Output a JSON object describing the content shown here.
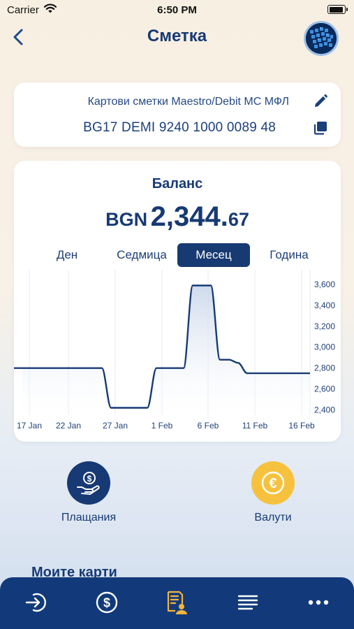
{
  "status_bar": {
    "carrier": "Carrier",
    "time": "6:50 PM"
  },
  "nav": {
    "title": "Сметка",
    "back_icon": "chevron-left-icon",
    "avatar": "profile-avatar"
  },
  "account": {
    "name": "Картови сметки Maestro/Debit MC МФЛ",
    "iban": "BG17 DEMI 9240 1000 0089 48",
    "edit_icon": "pencil-icon",
    "copy_icon": "copy-icon"
  },
  "balance": {
    "title": "Баланс",
    "currency": "BGN",
    "amount_integer": "2,344.",
    "amount_decimal": "67"
  },
  "periods": {
    "day": "Ден",
    "week": "Седмица",
    "month": "Месец",
    "year": "Година",
    "selected": "Месец"
  },
  "chart_data": {
    "type": "line",
    "x": [
      "12 Jan",
      "15 Jan",
      "16 Jan",
      "17 Jan",
      "22 Jan",
      "25 Jan",
      "26 Jan",
      "27 Jan",
      "30 Jan",
      "31 Jan",
      "1 Feb",
      "3 Feb",
      "4 Feb",
      "6 Feb",
      "7 Feb",
      "8 Feb",
      "9 Feb",
      "10 Feb",
      "16 Feb"
    ],
    "values": [
      2800,
      2800,
      2800,
      2800,
      2800,
      2800,
      2420,
      2420,
      2420,
      2800,
      2800,
      2800,
      3590,
      3590,
      2880,
      2880,
      2850,
      2750,
      2750
    ],
    "x_ticks": [
      "17 Jan",
      "22 Jan",
      "27 Jan",
      "1 Feb",
      "6 Feb",
      "11 Feb",
      "16 Feb"
    ],
    "y_ticks": [
      "2,400",
      "2,600",
      "2,800",
      "3,000",
      "3,200",
      "3,400",
      "3,600"
    ],
    "ylim": [
      2350,
      3700
    ],
    "grid": "vertical",
    "area_fill": true,
    "line_color": "#173a75"
  },
  "actions": {
    "payments": {
      "label": "Плащания",
      "icon": "hand-money-icon",
      "color": "#173a75"
    },
    "currencies": {
      "label": "Валути",
      "icon": "euro-icon",
      "color": "#f6c23e"
    }
  },
  "cards_heading": "Моите карти",
  "tabbar": {
    "items": [
      {
        "icon": "login-arrow-icon"
      },
      {
        "icon": "dollar-circle-icon"
      },
      {
        "icon": "document-user-icon",
        "active": true
      },
      {
        "icon": "menu-lines-icon"
      },
      {
        "icon": "more-dots-icon"
      }
    ],
    "active_color": "#f4b43d",
    "color": "#ffffff"
  }
}
